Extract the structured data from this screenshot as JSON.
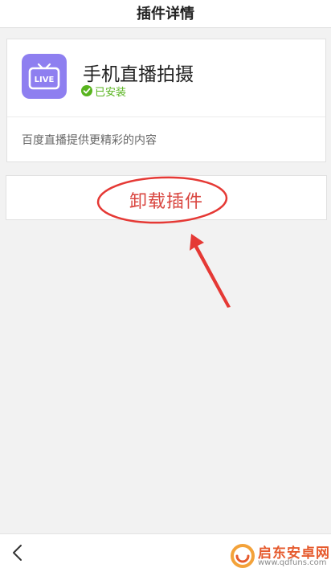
{
  "header": {
    "title": "插件详情"
  },
  "plugin": {
    "icon": "live-tv-icon",
    "icon_label": "LIVE",
    "name": "手机直播拍摄",
    "status": "已安装",
    "description": "百度直播提供更精彩的内容"
  },
  "actions": {
    "uninstall_label": "卸载插件"
  },
  "bottom_bar": {
    "back_icon": "chevron-left-icon"
  },
  "watermark": {
    "name": "启东安卓网",
    "url": "www.qdfuns.com"
  },
  "colors": {
    "background": "#f2f2f2",
    "icon_bg": "#8e7ff0",
    "installed_green": "#58b41e",
    "uninstall_red": "#d9453f",
    "annotation_red": "#e53935",
    "watermark_orange": "#e65a2d"
  }
}
